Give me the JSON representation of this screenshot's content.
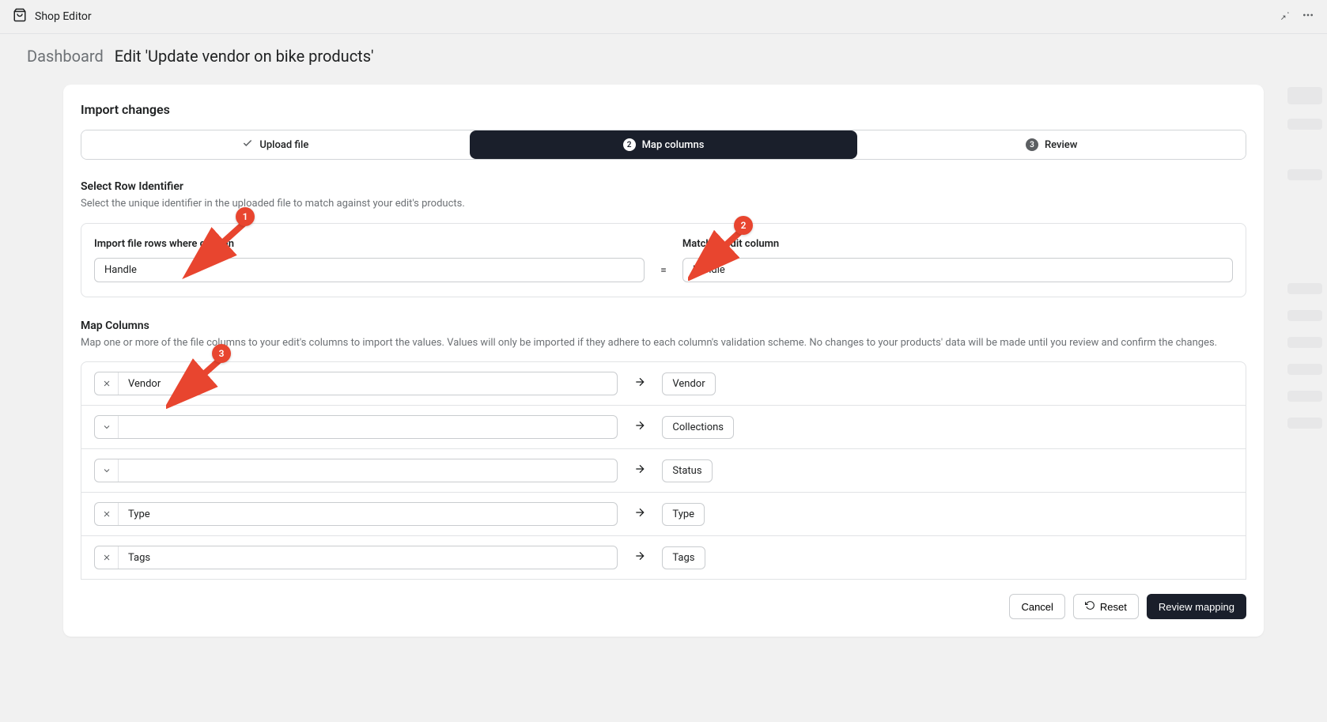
{
  "topbar": {
    "app_name": "Shop Editor"
  },
  "breadcrumb": {
    "dashboard": "Dashboard",
    "current": "Edit 'Update vendor on bike products'"
  },
  "card": {
    "title": "Import changes"
  },
  "steps": {
    "upload": "Upload file",
    "map": "Map columns",
    "review": "Review",
    "map_num": "2",
    "review_num": "3"
  },
  "identifier": {
    "heading": "Select Row Identifier",
    "sub": "Select the unique identifier in the uploaded file to match against your edit's products.",
    "left_label": "Import file rows where column",
    "right_label": "Matches edit column",
    "left_value": "Handle",
    "right_value": "Handle",
    "equals": "="
  },
  "mapcols": {
    "heading": "Map Columns",
    "sub": "Map one or more of the file columns to your edit's columns to import the values. Values will only be imported if they adhere to each column's validation scheme. No changes to your products' data will be made until you review and confirm the changes.",
    "rows": [
      {
        "icon": "x",
        "source": "Vendor",
        "target": "Vendor"
      },
      {
        "icon": "chevron",
        "source": "",
        "target": "Collections"
      },
      {
        "icon": "chevron",
        "source": "",
        "target": "Status"
      },
      {
        "icon": "x",
        "source": "Type",
        "target": "Type"
      },
      {
        "icon": "x",
        "source": "Tags",
        "target": "Tags"
      }
    ]
  },
  "footer": {
    "cancel": "Cancel",
    "reset": "Reset",
    "review": "Review mapping"
  },
  "annotations": {
    "one": "1",
    "two": "2",
    "three": "3"
  }
}
